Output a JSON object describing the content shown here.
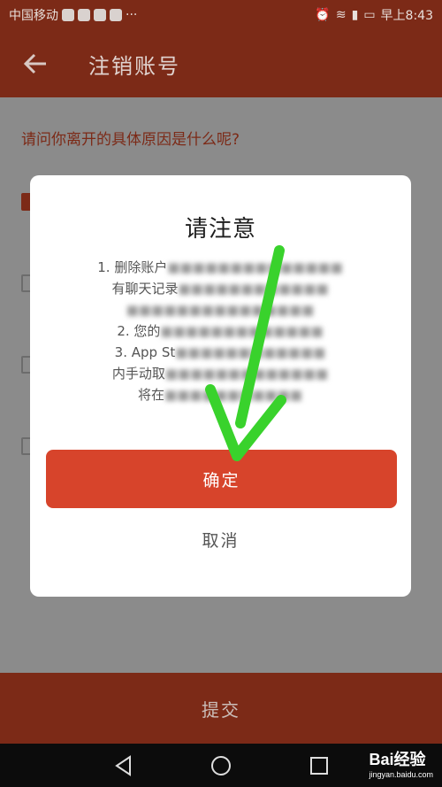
{
  "status_bar": {
    "carrier": "中国移动",
    "time": "早上8:43",
    "dots": "···"
  },
  "app_bar": {
    "title": "注销账号",
    "back_icon": "arrow-left-icon"
  },
  "content": {
    "question": "请问你离开的具体原因是什么呢?"
  },
  "dialog": {
    "title": "请注意",
    "body_lines": [
      "1. 删除账户",
      "有聊天记录",
      "2. 您的",
      "3. App St",
      "内手动取",
      "将在"
    ],
    "confirm_label": "确定",
    "cancel_label": "取消"
  },
  "submit_label": "提交",
  "watermark": {
    "brand": "Bai经验",
    "url": "jingyan.baidu.com"
  },
  "colors": {
    "accent": "#d7442b",
    "arrow": "#39d22c"
  }
}
